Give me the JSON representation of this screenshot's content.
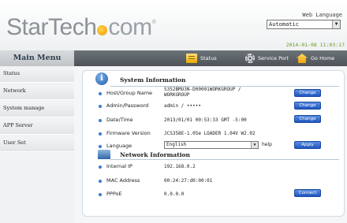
{
  "header": {
    "logo_left": "StarTech",
    "logo_right": "com",
    "logo_reg": "®",
    "language_label": "Web Language",
    "language_value": "Automatic",
    "datetime": "2014-01-08 11:03:17"
  },
  "menu": {
    "title": "Main Menu",
    "items": [
      "Status",
      "Network",
      "System manage",
      "APP Server",
      "User Set"
    ]
  },
  "nav": {
    "status": "Status",
    "service_port": "Service Port",
    "go_home": "Go Home"
  },
  "system": {
    "title": "System Information",
    "host_label": "Host/Group Name",
    "host_value_1": "S352BMU3N-D00001WORKGROUP /",
    "host_value_2": "WORKGROUP",
    "admin_label": "Admin/Password",
    "admin_value": "admin / •••••",
    "date_label": "Date/Time",
    "date_value": "2013/01/01 00:53:33 GMT -5:00",
    "firmware_label": "Firmware Version",
    "firmware_value": "JCS358E-1.05e LOADER 1.04V W2.02",
    "language_label": "Language",
    "language_value": "English",
    "help": "help",
    "change": "Change",
    "apply": "Apply"
  },
  "network": {
    "title": "Network Information",
    "ip_label": "Internal IP",
    "ip_value": "192.168.0.2",
    "mac_label": "MAC Address",
    "mac_value": "00:24:27:d0:00:01",
    "pppoe_label": "PPPoE",
    "pppoe_value": "0.0.0.0",
    "connect": "Connect"
  },
  "colors": {
    "accent": "#2f6fd6",
    "date_green": "#6a9a22",
    "nav_dark": "#555b60"
  }
}
